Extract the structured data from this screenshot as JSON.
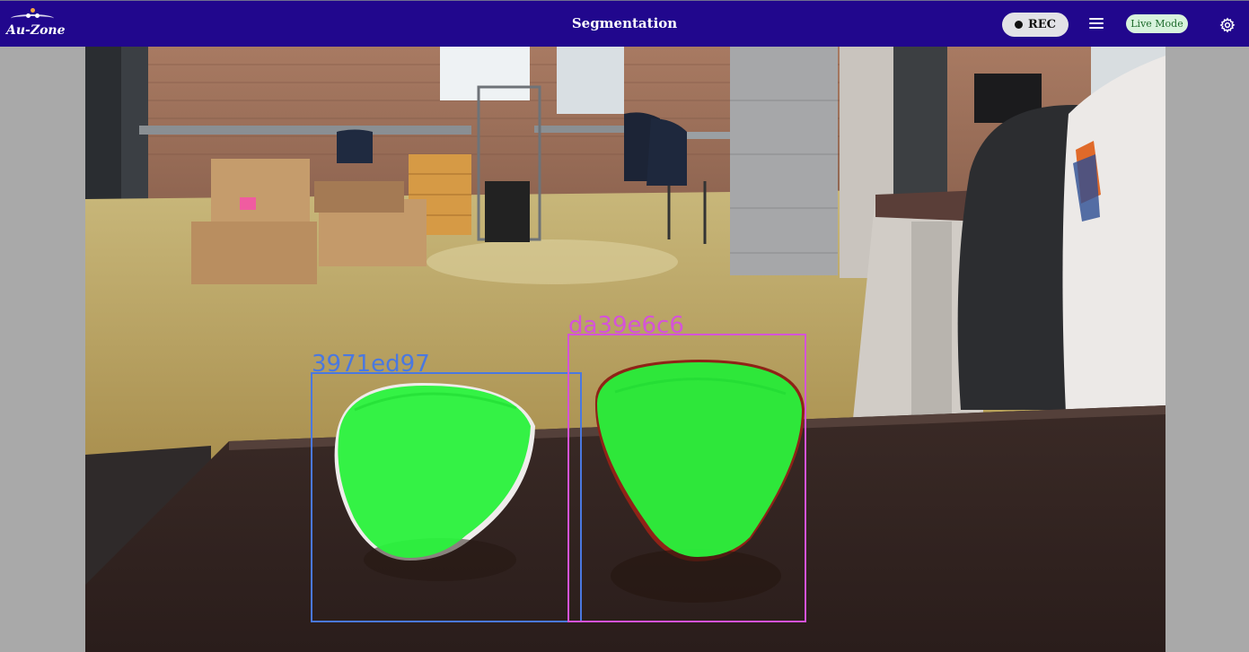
{
  "header": {
    "logo_text": "Au-Zone",
    "title": "Segmentation",
    "rec_label": "REC",
    "live_mode_label": "Live Mode"
  },
  "icons": {
    "record": "record-dot-icon",
    "menu": "hamburger-menu-icon",
    "settings": "gear-icon"
  },
  "colors": {
    "header_bg": "#21078d",
    "mask_fill": "#29f23c",
    "detection_1": "#4a78e0",
    "detection_2": "#d553d8"
  },
  "detections": [
    {
      "id": "3971ed97",
      "color": "#4a78e0"
    },
    {
      "id": "da39e6c6",
      "color": "#d553d8"
    }
  ]
}
